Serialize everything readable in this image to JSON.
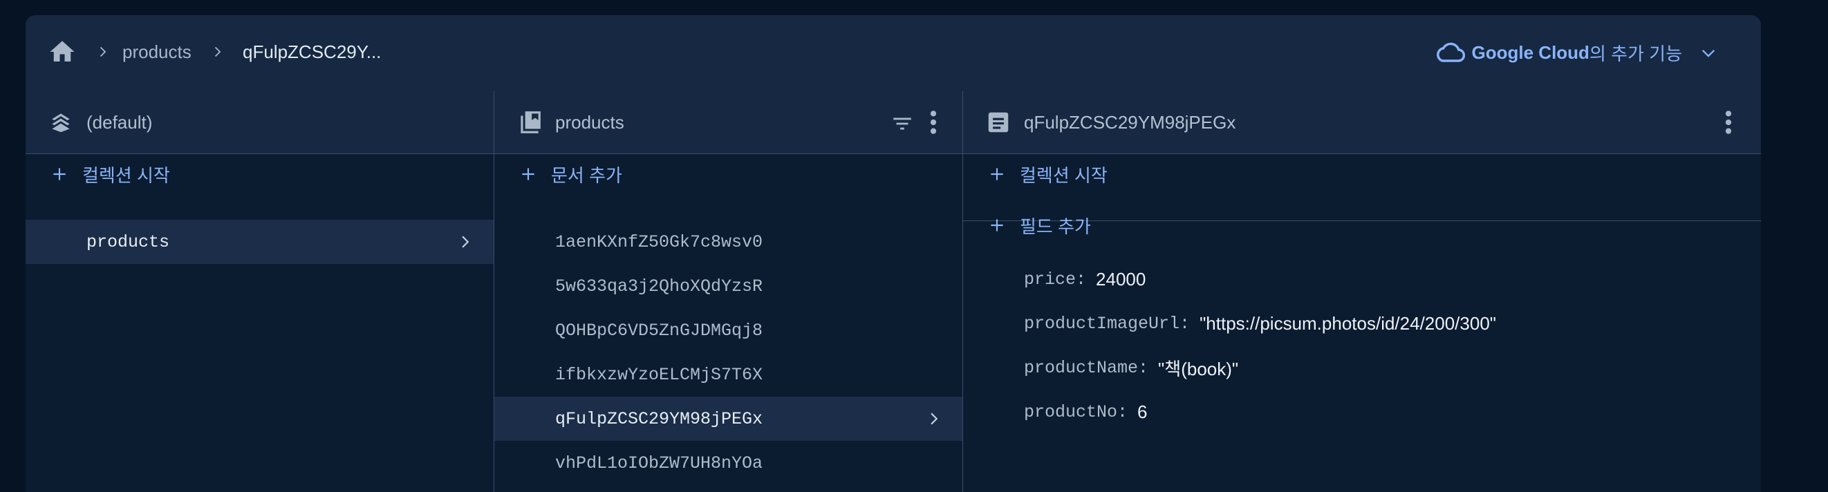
{
  "breadcrumb": {
    "items": [
      "products",
      "qFulpZCSC29Y..."
    ]
  },
  "header": {
    "google_cloud_brand": "Google Cloud",
    "google_cloud_rest": "의 추가 기능"
  },
  "colors": {
    "accent": "#8ab4f8",
    "panel": "#0b1b30",
    "header": "#162842",
    "page": "#051324"
  },
  "columns": {
    "root": {
      "title": "(default)",
      "add_label": "컬렉션 시작",
      "items": [
        "products"
      ]
    },
    "collection": {
      "title": "products",
      "add_label": "문서 추가",
      "items": [
        "1aenKXnfZ50Gk7c8wsv0",
        "5w633qa3j2QhoXQdYzsR",
        "QOHBpC6VD5ZnGJDMGqj8",
        "ifbkxzwYzoELCMjS7T6X",
        "qFulpZCSC29YM98jPEGx",
        "vhPdL1oIObZW7UH8nYOa"
      ]
    },
    "document": {
      "title": "qFulpZCSC29YM98jPEGx",
      "add_collection_label": "컬렉션 시작",
      "add_field_label": "필드 추가",
      "fields": [
        {
          "key": "price",
          "value": "24000"
        },
        {
          "key": "productImageUrl",
          "value": "\"https://picsum.photos/id/24/200/300\""
        },
        {
          "key": "productName",
          "value": "\"책(book)\""
        },
        {
          "key": "productNo",
          "value": "6"
        }
      ]
    }
  },
  "icons": {
    "home": "home-icon",
    "chevron": "chevron-right-icon",
    "cloud": "cloud-icon",
    "expand": "chevron-down-icon",
    "database": "database-icon",
    "collection": "collection-icon",
    "document": "document-icon",
    "filter": "filter-icon",
    "more": "more-vert-icon",
    "add": "plus-icon"
  }
}
